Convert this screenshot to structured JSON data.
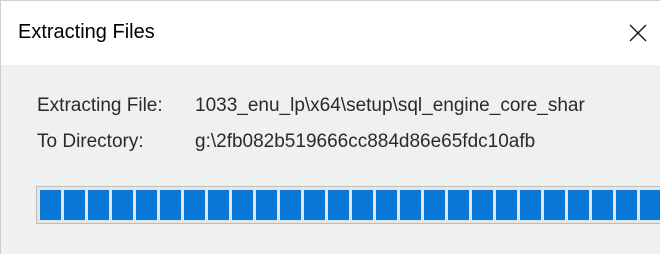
{
  "window": {
    "title": "Extracting Files",
    "close_icon": "close-icon"
  },
  "details": {
    "file_label": "Extracting File:",
    "file_value": "1033_enu_lp\\x64\\setup\\sql_engine_core_shar",
    "dir_label": "To Directory:",
    "dir_value": "g:\\2fb082b519666cc884d86e65fdc10afb"
  },
  "progress": {
    "fraction": 1.0,
    "color": "#0a78d7",
    "segments": 26
  }
}
